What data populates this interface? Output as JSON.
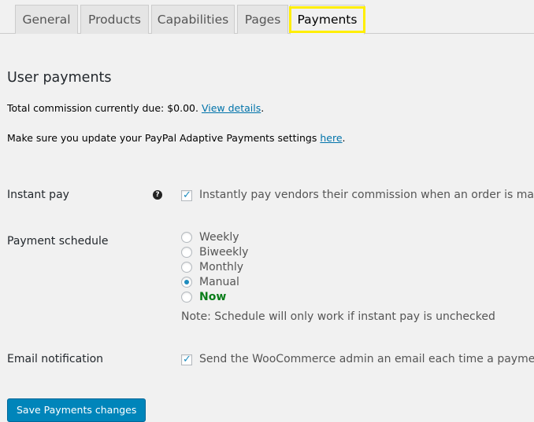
{
  "tabs": [
    {
      "label": "General",
      "active": false
    },
    {
      "label": "Products",
      "active": false
    },
    {
      "label": "Capabilities",
      "active": false
    },
    {
      "label": "Pages",
      "active": false
    },
    {
      "label": "Payments",
      "active": true
    }
  ],
  "highlight_color": "#ffee00",
  "accent_color": "#0085ba",
  "section": {
    "title": "User payments",
    "commission_text": "Total commission currently due: $0.00. ",
    "commission_link": "View details",
    "commission_suffix": ".",
    "paypal_text": "Make sure you update your PayPal Adaptive Payments settings ",
    "paypal_link": "here",
    "paypal_suffix": "."
  },
  "instant_pay": {
    "label": "Instant pay",
    "help_icon": "question-circle-icon",
    "checked": true,
    "description": "Instantly pay vendors their commission when an order is made"
  },
  "payment_schedule": {
    "label": "Payment schedule",
    "options": [
      {
        "label": "Weekly",
        "selected": false
      },
      {
        "label": "Biweekly",
        "selected": false
      },
      {
        "label": "Monthly",
        "selected": false
      },
      {
        "label": "Manual",
        "selected": true
      },
      {
        "label": "Now",
        "selected": false
      }
    ],
    "note": "Note: Schedule will only work if instant pay is unchecked"
  },
  "email_notification": {
    "label": "Email notification",
    "checked": true,
    "description": "Send the WooCommerce admin an email each time a payment l"
  },
  "save_button": {
    "label": "Save Payments changes"
  }
}
